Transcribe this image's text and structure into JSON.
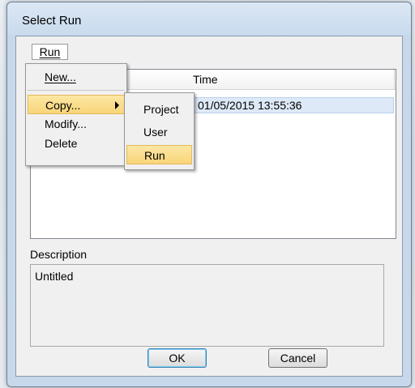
{
  "window": {
    "title": "Select Run"
  },
  "menubar": {
    "run_label": "Run"
  },
  "list": {
    "columns": [
      "Time"
    ],
    "rows": [
      {
        "time": "01/05/2015 13:55:36"
      }
    ]
  },
  "description": {
    "label": "Description",
    "value": "Untitled"
  },
  "buttons": {
    "ok": "OK",
    "cancel": "Cancel"
  },
  "run_menu": {
    "items": [
      "New...",
      "Copy...",
      "Modify...",
      "Delete"
    ]
  },
  "copy_submenu": {
    "items": [
      "Project",
      "User",
      "Run"
    ]
  }
}
